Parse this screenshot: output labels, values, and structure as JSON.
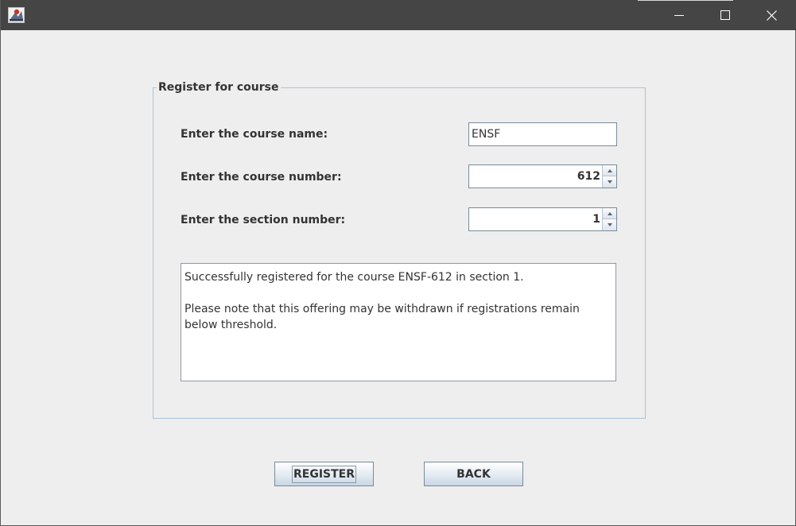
{
  "window": {
    "icon": "java-app-icon",
    "controls": [
      "minimize-icon",
      "maximize-icon",
      "close-icon"
    ]
  },
  "form": {
    "group_title": "Register for course",
    "course_name_label": "Enter the course name:",
    "course_name_value": "ENSF",
    "course_number_label": "Enter the course number:",
    "course_number_value": "612",
    "section_number_label": "Enter the section number:",
    "section_number_value": "1",
    "message": "Successfully registered for the course ENSF-612 in section 1.\n\nPlease note that this offering may be withdrawn if registrations remain below threshold."
  },
  "buttons": {
    "register_label": "REGISTER",
    "back_label": "BACK"
  },
  "colors": {
    "titlebar": "#454545",
    "background": "#eeeeee",
    "group_border": "#a9c4de"
  }
}
